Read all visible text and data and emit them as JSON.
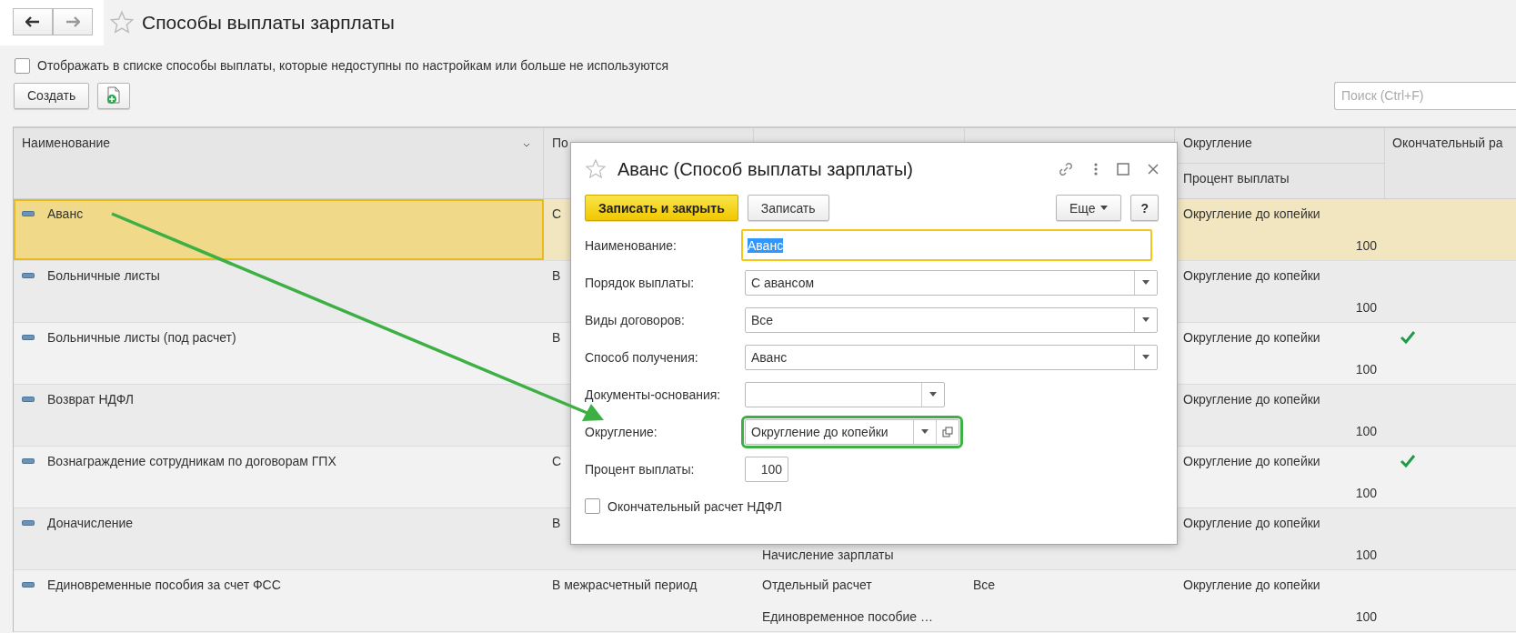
{
  "title": "Способы выплаты зарплаты",
  "show_unavailable": {
    "label": "Отображать в списке способы выплаты, которые недоступны по настройкам или больше не используются",
    "checked": false
  },
  "toolbar": {
    "create_button": "Создать"
  },
  "search": {
    "placeholder": "Поиск (Ctrl+F)"
  },
  "table": {
    "header": {
      "name": "Наименование",
      "column_2": "По",
      "rounding": "Округление",
      "percent": "Процент выплаты",
      "final_calc": "Окончательный ра"
    },
    "rows": [
      {
        "name": "Аванс",
        "column_2": "С",
        "rounding": "Округление до копейки",
        "percent": "100",
        "final": false,
        "selected": true
      },
      {
        "name": "Больничные листы",
        "column_2": "В",
        "rounding": "Округление до копейки",
        "percent": "100",
        "final": false,
        "selected": false
      },
      {
        "name": "Больничные листы (под расчет)",
        "column_2": "В",
        "rounding": "Округление до копейки",
        "percent": "100",
        "final": true,
        "selected": false
      },
      {
        "name": "Возврат НДФЛ",
        "rounding": "Округление до копейки",
        "percent": "100",
        "final": false,
        "selected": false
      },
      {
        "name": "Вознаграждение сотрудникам по договорам ГПХ",
        "column_2": "С",
        "rounding": "Округление до копейки",
        "percent": "100",
        "final": true,
        "selected": false
      },
      {
        "name": "Доначисление",
        "column_2": "В",
        "column_3_bottom": "Начисление зарплаты",
        "rounding": "Округление до копейки",
        "percent": "100",
        "final": false,
        "selected": false
      },
      {
        "name": "Единовременные пособия за счет ФСС",
        "column_2": "В межрасчетный период",
        "column_3": "Отдельный расчет",
        "column_3_bottom": "Единовременное пособие …",
        "column_4": "Все",
        "rounding": "Округление до копейки",
        "percent": "100",
        "final": false,
        "selected": false
      }
    ]
  },
  "dialog": {
    "title": "Аванс (Способ выплаты зарплаты)",
    "buttons": [
      {
        "label": "Записать и закрыть",
        "kind": "primary"
      },
      {
        "label": "Записать",
        "kind": "plain"
      }
    ],
    "more_button": "Еще",
    "help_button": "?",
    "fields": [
      {
        "kind": "text",
        "label": "Наименование:",
        "value": "Аванс",
        "focused": true
      },
      {
        "kind": "select",
        "label": "Порядок выплаты:",
        "value": "С авансом"
      },
      {
        "kind": "select",
        "label": "Виды договоров:",
        "value": "Все"
      },
      {
        "kind": "select",
        "label": "Способ получения:",
        "value": "Аванс"
      },
      {
        "kind": "short_select",
        "label": "Документы-основания:"
      },
      {
        "kind": "reference",
        "label": "Округление:",
        "value": "Округление до копейки",
        "highlighted": true
      },
      {
        "kind": "number",
        "label": "Процент выплаты:",
        "value": "100"
      },
      {
        "kind": "checkbox",
        "label": "Окончательный расчет НДФЛ",
        "checked": false
      }
    ]
  }
}
